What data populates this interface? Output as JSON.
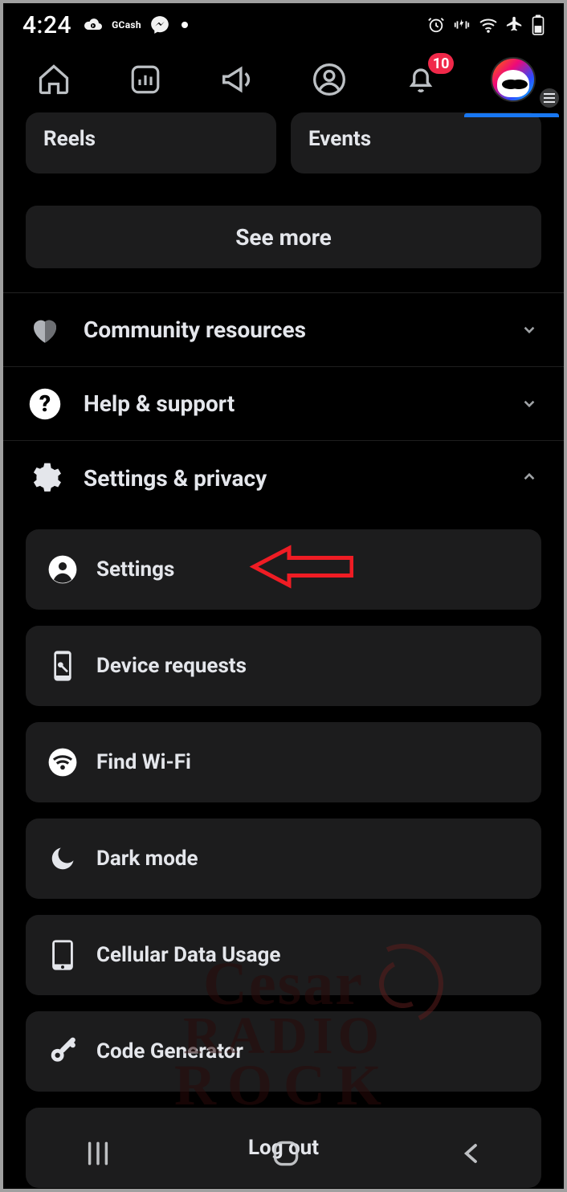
{
  "statusbar": {
    "time": "4:24",
    "gcash_label": "GCash",
    "notification_count": "10"
  },
  "shortcuts": {
    "reels": "Reels",
    "events": "Events",
    "see_more": "See more"
  },
  "sections": {
    "community": "Community resources",
    "help": "Help & support",
    "settings_privacy": "Settings & privacy"
  },
  "settings_items": {
    "settings": "Settings",
    "device_requests": "Device requests",
    "find_wifi": "Find Wi-Fi",
    "dark_mode": "Dark mode",
    "cellular": "Cellular Data Usage",
    "code_gen": "Code Generator",
    "logout": "Log out"
  },
  "watermark": {
    "l1": "Cesar",
    "l2": "RADIO",
    "l3": "ROCK"
  }
}
